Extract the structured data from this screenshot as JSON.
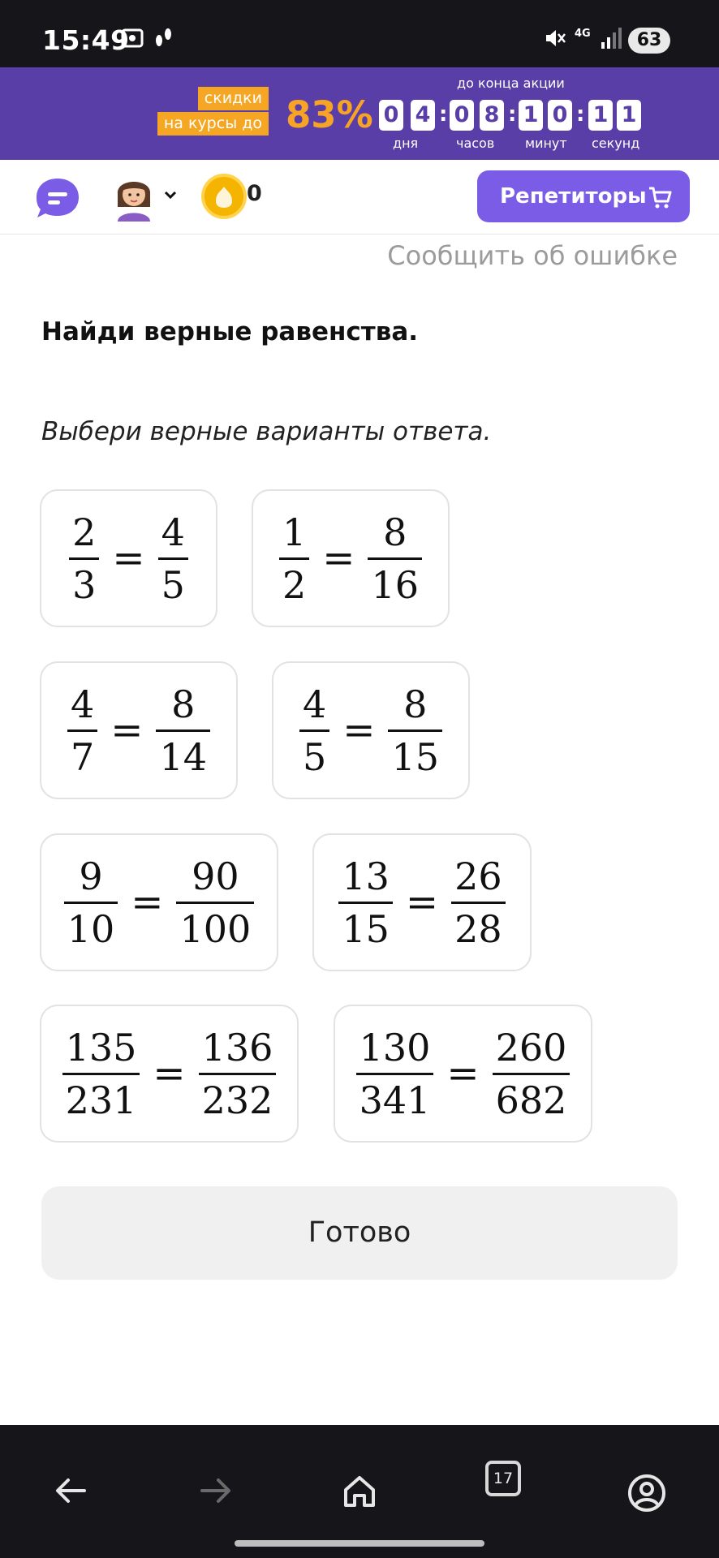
{
  "status_bar": {
    "time": "15:49",
    "network": "4G",
    "battery": "63",
    "icons": [
      "screenshot-icon",
      "steps-icon",
      "mute-icon",
      "signal-icon"
    ]
  },
  "promo": {
    "tag_line1": "скидки",
    "tag_line2": "на курсы до",
    "percent": "83%",
    "until": "до конца акции",
    "timer": [
      {
        "digits": [
          "0",
          "4"
        ],
        "unit": "дня"
      },
      {
        "digits": [
          "0",
          "8"
        ],
        "unit": "часов"
      },
      {
        "digits": [
          "1",
          "0"
        ],
        "unit": "минут"
      },
      {
        "digits": [
          "1",
          "1"
        ],
        "unit": "секунд"
      }
    ],
    "colors": {
      "background": "#5a3ea8",
      "accent": "#f5a623"
    }
  },
  "topnav": {
    "coin_count": "0",
    "tutor_button": "Репетиторы",
    "colors": {
      "button": "#7b5ce6"
    }
  },
  "report_link": "Сообщить об ошибке",
  "question": {
    "title": "Найди верные равенства.",
    "hint": "Выбери верные варианты ответа."
  },
  "options": [
    {
      "left": {
        "num": "2",
        "den": "3"
      },
      "right": {
        "num": "4",
        "den": "5"
      }
    },
    {
      "left": {
        "num": "1",
        "den": "2"
      },
      "right": {
        "num": "8",
        "den": "16"
      }
    },
    {
      "left": {
        "num": "4",
        "den": "7"
      },
      "right": {
        "num": "8",
        "den": "14"
      }
    },
    {
      "left": {
        "num": "4",
        "den": "5"
      },
      "right": {
        "num": "8",
        "den": "15"
      }
    },
    {
      "left": {
        "num": "9",
        "den": "10"
      },
      "right": {
        "num": "90",
        "den": "100"
      }
    },
    {
      "left": {
        "num": "13",
        "den": "15"
      },
      "right": {
        "num": "26",
        "den": "28"
      }
    },
    {
      "left": {
        "num": "135",
        "den": "231"
      },
      "right": {
        "num": "136",
        "den": "232"
      }
    },
    {
      "left": {
        "num": "130",
        "den": "341"
      },
      "right": {
        "num": "260",
        "den": "682"
      }
    }
  ],
  "equals_sign": "=",
  "done_button": "Готово",
  "bottom_nav": {
    "tabs_count": "17",
    "icons": [
      "back-arrow-icon",
      "forward-arrow-icon",
      "home-icon",
      "tabs-icon",
      "profile-icon"
    ]
  }
}
